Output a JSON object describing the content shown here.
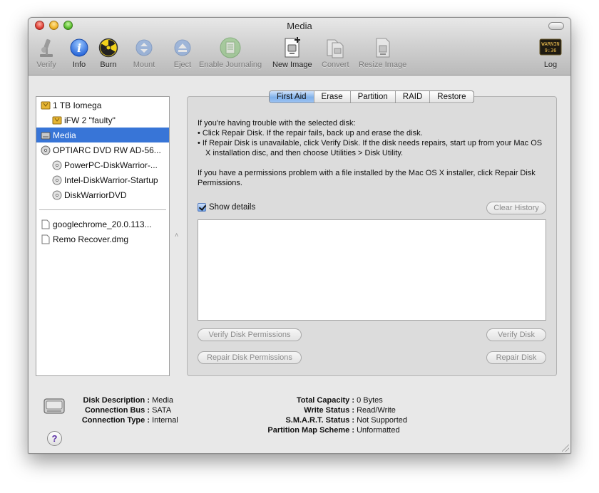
{
  "window": {
    "title": "Media"
  },
  "toolbar": [
    {
      "label": "Verify",
      "icon": "microscope-icon",
      "enabled": false
    },
    {
      "label": "Info",
      "icon": "info-icon",
      "enabled": true
    },
    {
      "label": "Burn",
      "icon": "radiation-icon",
      "enabled": true
    },
    {
      "label": "Mount",
      "icon": "mount-icon",
      "enabled": false
    },
    {
      "label": "Eject",
      "icon": "eject-icon",
      "enabled": false
    },
    {
      "label": "Enable Journaling",
      "icon": "journaling-icon",
      "enabled": false
    },
    {
      "label": "New Image",
      "icon": "new-image-icon",
      "enabled": true
    },
    {
      "label": "Convert",
      "icon": "convert-icon",
      "enabled": false
    },
    {
      "label": "Resize Image",
      "icon": "resize-image-icon",
      "enabled": false
    },
    {
      "label": "Log",
      "icon": "log-icon",
      "enabled": true
    }
  ],
  "log_icon_text": [
    "WARNIN",
    "9:36"
  ],
  "sidebar": {
    "items": [
      {
        "label": "1 TB Iomega",
        "icon": "external-drive-icon",
        "indent": 0
      },
      {
        "label": "iFW 2 \"faulty\"",
        "icon": "volume-icon",
        "indent": 1
      },
      {
        "label": "Media",
        "icon": "internal-disk-icon",
        "indent": 0,
        "selected": true
      },
      {
        "label": "OPTIARC DVD RW AD-56...",
        "icon": "optical-drive-icon",
        "indent": 0
      },
      {
        "label": "PowerPC-DiskWarrior-...",
        "icon": "disc-icon",
        "indent": 1
      },
      {
        "label": "Intel-DiskWarrior-Startup",
        "icon": "disc-icon",
        "indent": 1
      },
      {
        "label": "DiskWarriorDVD",
        "icon": "disc-icon",
        "indent": 1
      }
    ],
    "images": [
      {
        "label": "googlechrome_20.0.113...",
        "icon": "document-icon"
      },
      {
        "label": "Remo Recover.dmg",
        "icon": "document-icon"
      }
    ]
  },
  "tabs": [
    {
      "label": "First Aid",
      "active": true
    },
    {
      "label": "Erase"
    },
    {
      "label": "Partition"
    },
    {
      "label": "RAID"
    },
    {
      "label": "Restore"
    }
  ],
  "first_aid": {
    "intro": "If you're having trouble with the selected disk:",
    "bullet1": "• Click Repair Disk. If the repair fails, back up and erase the disk.",
    "bullet2": "• If Repair Disk is unavailable, click Verify Disk. If the disk needs repairs, start up from your Mac OS X installation disc, and then choose Utilities > Disk Utility.",
    "permissions": "If you have a permissions problem with a file installed by the Mac OS X installer, click Repair Disk Permissions.",
    "show_details_label": "Show details",
    "show_details_checked": true,
    "clear_history": "Clear History",
    "verify_permissions": "Verify Disk Permissions",
    "repair_permissions": "Repair Disk Permissions",
    "verify_disk": "Verify Disk",
    "repair_disk": "Repair Disk"
  },
  "disk_info": {
    "left": [
      {
        "key": "Disk Description :",
        "value": "Media"
      },
      {
        "key": "Connection Bus :",
        "value": "SATA"
      },
      {
        "key": "Connection Type :",
        "value": "Internal"
      }
    ],
    "right": [
      {
        "key": "Total Capacity :",
        "value": "0 Bytes"
      },
      {
        "key": "Write Status :",
        "value": "Read/Write"
      },
      {
        "key": "S.M.A.R.T. Status :",
        "value": "Not Supported"
      },
      {
        "key": "Partition Map Scheme :",
        "value": "Unformatted"
      }
    ]
  },
  "help_glyph": "?",
  "colors": {
    "selection": "#3875d7",
    "active_tab": "#7fb0ea"
  }
}
